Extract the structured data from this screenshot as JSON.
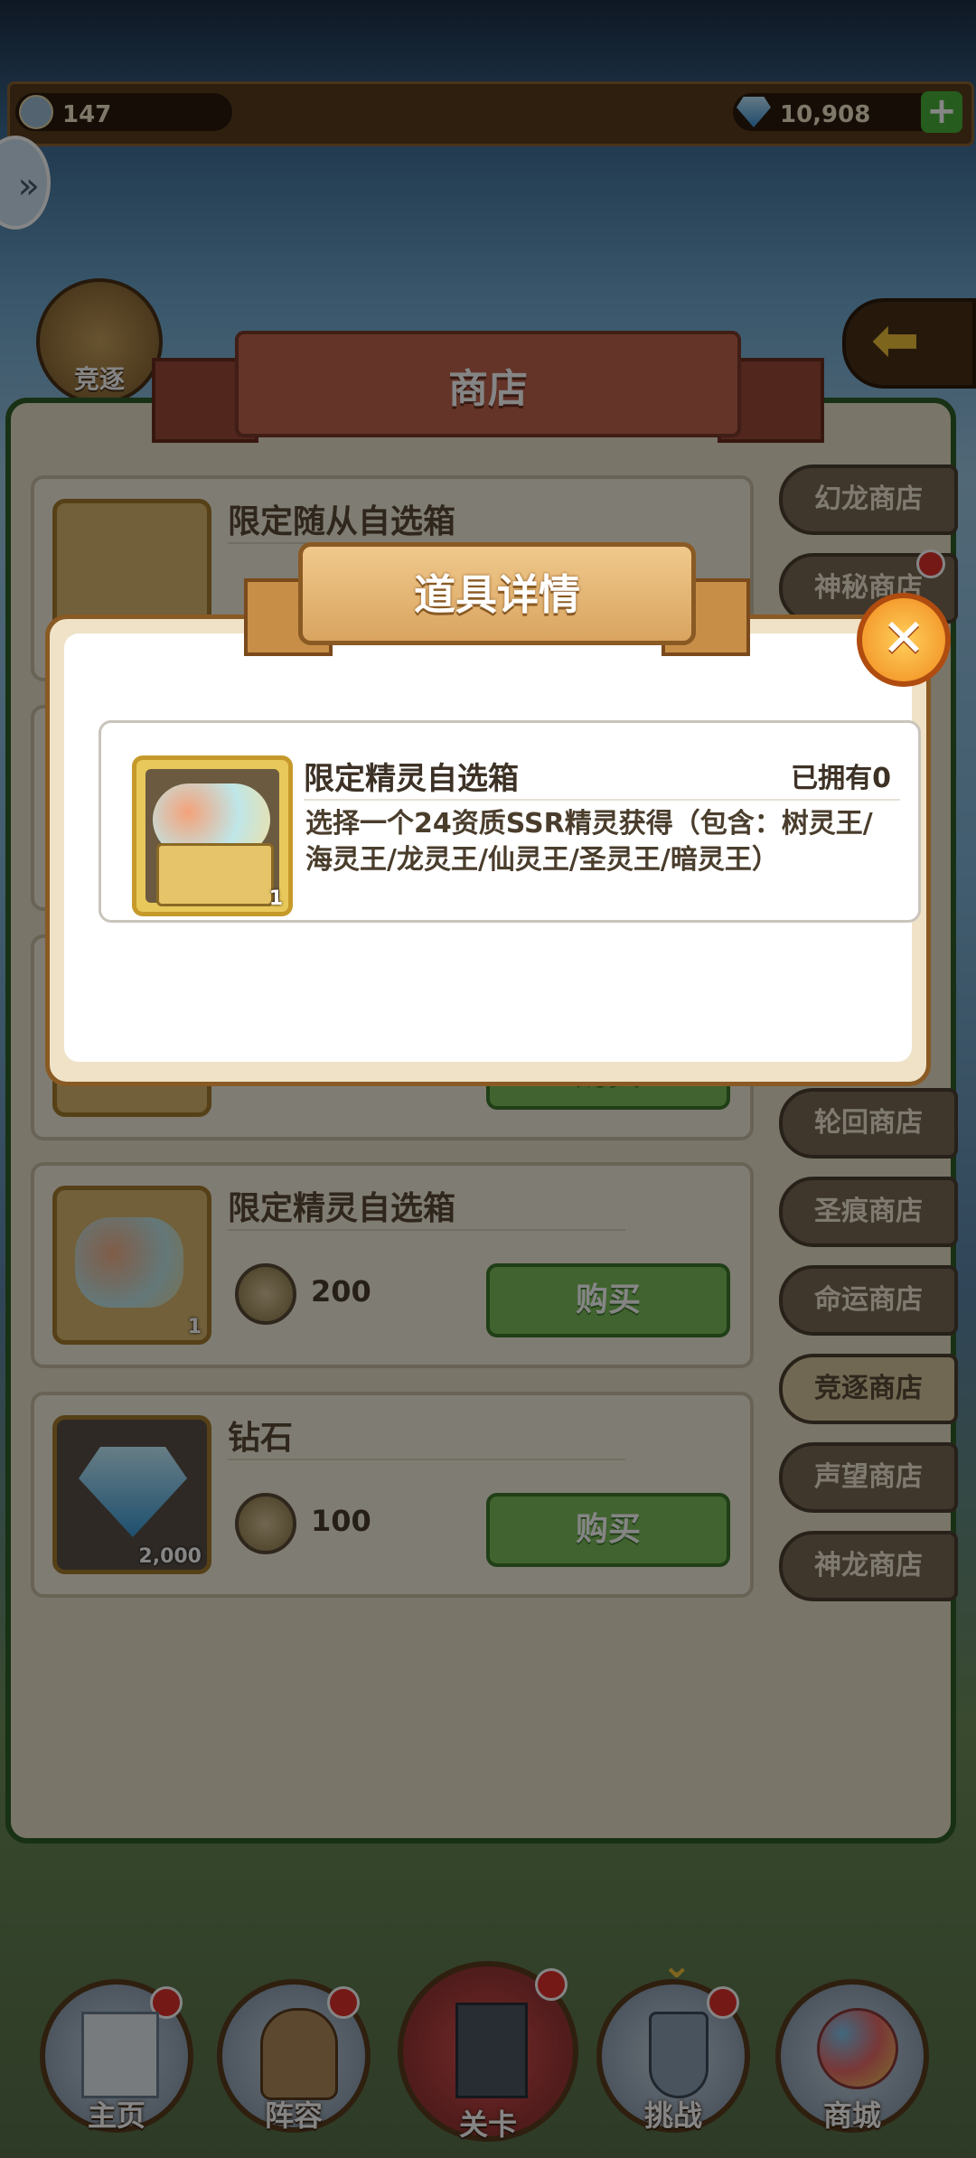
{
  "currency": {
    "token_count": "147",
    "diamond_count": "10,908",
    "add_label": "+"
  },
  "header": {
    "compete_label": "竞逐",
    "shop_title": "商店"
  },
  "shop_items": [
    {
      "name": "限定随从自选箱",
      "price": "",
      "buy_label": "购买",
      "qty": ""
    },
    {
      "name": "限定精灵自选箱",
      "price": "200",
      "buy_label": "购买",
      "qty": "1"
    },
    {
      "name": "钻石",
      "price": "100",
      "buy_label": "购买",
      "qty": "2,000"
    }
  ],
  "shop_tabs": [
    {
      "label": "幻龙商店"
    },
    {
      "label": "神秘商店"
    },
    {
      "label": "轮回商店"
    },
    {
      "label": "圣痕商店"
    },
    {
      "label": "命运商店"
    },
    {
      "label": "竞逐商店"
    },
    {
      "label": "声望商店"
    },
    {
      "label": "神龙商店"
    }
  ],
  "bottom_nav": [
    {
      "label": "主页"
    },
    {
      "label": "阵容"
    },
    {
      "label": "关卡"
    },
    {
      "label": "挑战"
    },
    {
      "label": "商城"
    }
  ],
  "modal": {
    "title": "道具详情",
    "item_name": "限定精灵自选箱",
    "owned": "已拥有0",
    "qty": "1",
    "description": "选择一个24资质SSR精灵获得（包含：树灵王/海灵王/龙灵王/仙灵王/圣灵王/暗灵王）",
    "close_icon": "close-icon"
  },
  "colors": {
    "accent_green": "#7dbf5a",
    "close_orange": "#f08a1e",
    "notification_red": "#e0312c"
  }
}
